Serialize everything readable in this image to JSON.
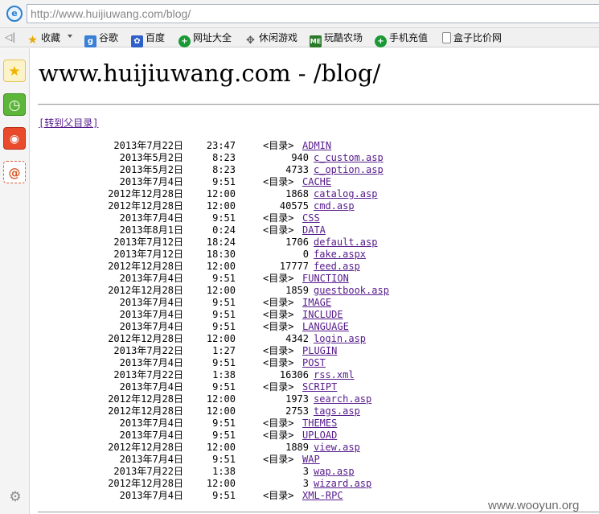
{
  "browser": {
    "address": "http://www.huijiuwang.com/blog/",
    "favorites": [
      {
        "label": "收藏",
        "icon": "star-icon"
      },
      {
        "label": "谷歌",
        "icon": "google-icon"
      },
      {
        "label": "百度",
        "icon": "baidu-paw-icon"
      },
      {
        "label": "网址大全",
        "icon": "green-plus-icon"
      },
      {
        "label": "休闲游戏",
        "icon": "gamepad-icon"
      },
      {
        "label": "玩酷农场",
        "icon": "me-icon"
      },
      {
        "label": "手机充值",
        "icon": "green-plus-icon"
      },
      {
        "label": "盒子比价网",
        "icon": "document-icon"
      }
    ]
  },
  "page": {
    "title": "www.huijiuwang.com - /blog/",
    "parent_link": "[转到父目录]",
    "dir_label": "<目录>"
  },
  "listing": [
    {
      "date": "2013年7月22日",
      "time": "23:47",
      "size": "<目录>",
      "name": "ADMIN",
      "dir": true
    },
    {
      "date": "2013年5月2日",
      "time": "8:23",
      "size": "940",
      "name": "c_custom.asp",
      "dir": false
    },
    {
      "date": "2013年5月2日",
      "time": "8:23",
      "size": "4733",
      "name": "c_option.asp",
      "dir": false
    },
    {
      "date": "2013年7月4日",
      "time": "9:51",
      "size": "<目录>",
      "name": "CACHE",
      "dir": true
    },
    {
      "date": "2012年12月28日",
      "time": "12:00",
      "size": "1868",
      "name": "catalog.asp",
      "dir": false
    },
    {
      "date": "2012年12月28日",
      "time": "12:00",
      "size": "40575",
      "name": "cmd.asp",
      "dir": false
    },
    {
      "date": "2013年7月4日",
      "time": "9:51",
      "size": "<目录>",
      "name": "CSS",
      "dir": true
    },
    {
      "date": "2013年8月1日",
      "time": "0:24",
      "size": "<目录>",
      "name": "DATA",
      "dir": true
    },
    {
      "date": "2013年7月12日",
      "time": "18:24",
      "size": "1706",
      "name": "default.asp",
      "dir": false
    },
    {
      "date": "2013年7月12日",
      "time": "18:30",
      "size": "0",
      "name": "fake.aspx",
      "dir": false
    },
    {
      "date": "2012年12月28日",
      "time": "12:00",
      "size": "17777",
      "name": "feed.asp",
      "dir": false
    },
    {
      "date": "2013年7月4日",
      "time": "9:51",
      "size": "<目录>",
      "name": "FUNCTION",
      "dir": true
    },
    {
      "date": "2012年12月28日",
      "time": "12:00",
      "size": "1859",
      "name": "guestbook.asp",
      "dir": false
    },
    {
      "date": "2013年7月4日",
      "time": "9:51",
      "size": "<目录>",
      "name": "IMAGE",
      "dir": true
    },
    {
      "date": "2013年7月4日",
      "time": "9:51",
      "size": "<目录>",
      "name": "INCLUDE",
      "dir": true
    },
    {
      "date": "2013年7月4日",
      "time": "9:51",
      "size": "<目录>",
      "name": "LANGUAGE",
      "dir": true
    },
    {
      "date": "2012年12月28日",
      "time": "12:00",
      "size": "4342",
      "name": "login.asp",
      "dir": false
    },
    {
      "date": "2013年7月22日",
      "time": "1:27",
      "size": "<目录>",
      "name": "PLUGIN",
      "dir": true
    },
    {
      "date": "2013年7月4日",
      "time": "9:51",
      "size": "<目录>",
      "name": "POST",
      "dir": true
    },
    {
      "date": "2013年7月22日",
      "time": "1:38",
      "size": "16306",
      "name": "rss.xml",
      "dir": false
    },
    {
      "date": "2013年7月4日",
      "time": "9:51",
      "size": "<目录>",
      "name": "SCRIPT",
      "dir": true
    },
    {
      "date": "2012年12月28日",
      "time": "12:00",
      "size": "1973",
      "name": "search.asp",
      "dir": false
    },
    {
      "date": "2012年12月28日",
      "time": "12:00",
      "size": "2753",
      "name": "tags.asp",
      "dir": false
    },
    {
      "date": "2013年7月4日",
      "time": "9:51",
      "size": "<目录>",
      "name": "THEMES",
      "dir": true
    },
    {
      "date": "2013年7月4日",
      "time": "9:51",
      "size": "<目录>",
      "name": "UPLOAD",
      "dir": true
    },
    {
      "date": "2012年12月28日",
      "time": "12:00",
      "size": "1889",
      "name": "view.asp",
      "dir": false
    },
    {
      "date": "2013年7月4日",
      "time": "9:51",
      "size": "<目录>",
      "name": "WAP",
      "dir": true
    },
    {
      "date": "2013年7月22日",
      "time": "1:38",
      "size": "3",
      "name": "wap.asp",
      "dir": false
    },
    {
      "date": "2012年12月28日",
      "time": "12:00",
      "size": "3",
      "name": "wizard.asp",
      "dir": false
    },
    {
      "date": "2013年7月4日",
      "time": "9:51",
      "size": "<目录>",
      "name": "XML-RPC",
      "dir": true
    }
  ],
  "watermark": "www.wooyun.org",
  "colors": {
    "link_visited": "#551a8b",
    "address_text": "#888888",
    "chrome_bg": "#f0f0f0"
  }
}
